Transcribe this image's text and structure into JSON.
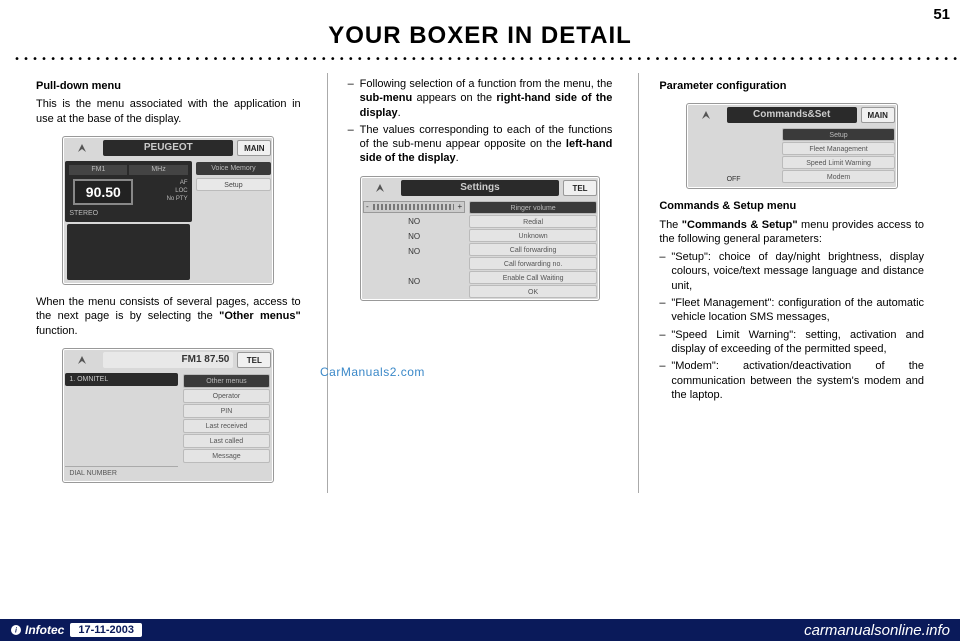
{
  "page": {
    "number": "51",
    "title": "YOUR BOXER IN DETAIL",
    "dots": "•••••••••••••••••••••••••••••••••••••••••••••••••••••••••••••••••••••••••••••••••••••••••••••••••••••••••••••••••••••••••••"
  },
  "col1": {
    "h1": "Pull-down menu",
    "p1a": "This is the menu associated with the application in use at the base of the display.",
    "p2a": "When the menu consists of several pages, access to the next page is by selecting the ",
    "p2b": "\"Other menus\"",
    "p2c": " function."
  },
  "col2": {
    "li1a": "Following selection of a function from the menu, the ",
    "li1b": "sub-menu",
    "li1c": " appears on the ",
    "li1d": "right-hand side of the display",
    "li1e": ".",
    "li2a": "The values corresponding to each of the functions of the sub-menu appear opposite on the ",
    "li2b": "left-hand side of the display",
    "li2c": "."
  },
  "col3": {
    "h1": "Parameter configuration",
    "h2": "Commands & Setup menu",
    "p1a": "The ",
    "p1b": "\"Commands & Setup\"",
    "p1c": " menu provides access to the following general parameters:",
    "li1": "\"Setup\": choice of day/night brightness, display colours, voice/text message language and distance unit,",
    "li2": "\"Fleet Management\": configuration of the automatic vehicle location SMS messages,",
    "li3": "\"Speed Limit Warning\": setting, activation and display of exceeding of the permitted speed,",
    "li4": "\"Modem\": activation/deactivation of the communication between the system's modem and the laptop."
  },
  "screen_radio": {
    "title": "PEUGEOT",
    "corner": "MAIN",
    "fm1": "FM1",
    "mhz": "MHz",
    "freq": "90.50",
    "af": "AF",
    "loc": "LOC",
    "nopty": "No PTY",
    "stereo": "STEREO",
    "voice": "Voice Memory",
    "setup": "Setup"
  },
  "screen_tel": {
    "title_fm": "FM1  87.50",
    "corner": "TEL",
    "omni": "1. OMNITEL",
    "other": "Other menus",
    "operator": "Operator",
    "pin": "PIN",
    "lastrec": "Last received",
    "lastcall": "Last called",
    "message": "Message",
    "dial": "DIAL NUMBER"
  },
  "screen_settings": {
    "title": "Settings",
    "corner": "TEL",
    "ringer": "Ringer volume",
    "no": "NO",
    "redial": "Redial",
    "unknown": "Unknown",
    "callfwd": "Call forwarding",
    "callfwdno": "Call forwarding no.",
    "enablecw": "Enable Call Waiting",
    "ok": "OK"
  },
  "screen_cmd": {
    "title": "Commands&Set",
    "corner": "MAIN",
    "setup": "Setup",
    "fleet": "Fleet Management",
    "speed": "Speed Limit Warning",
    "modem": "Modem",
    "off": "OFF"
  },
  "watermark": "CarManuals2.com",
  "footer": {
    "brand": "Infotec",
    "date": "17-11-2003",
    "site": "carmanualsonline.info"
  }
}
